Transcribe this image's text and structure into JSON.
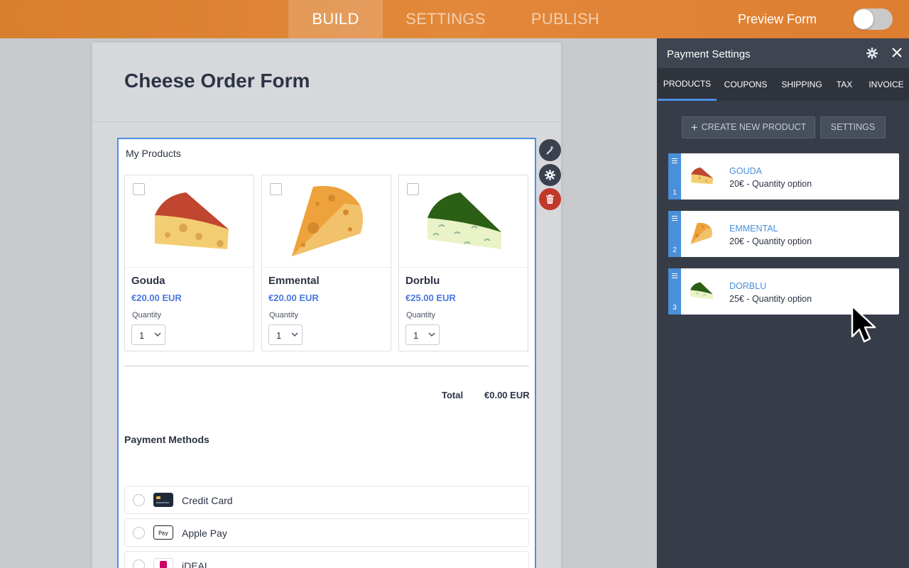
{
  "topbar": {
    "tabs": [
      {
        "label": "BUILD",
        "active": true
      },
      {
        "label": "SETTINGS",
        "active": false
      },
      {
        "label": "PUBLISH",
        "active": false
      }
    ],
    "preview_label": "Preview Form",
    "preview_on": false
  },
  "form": {
    "title": "Cheese Order Form",
    "block_label": "My Products",
    "products": [
      {
        "name": "Gouda",
        "price": "€20.00 EUR",
        "quantity_label": "Quantity",
        "quantity": "1",
        "color": "#c0462f"
      },
      {
        "name": "Emmental",
        "price": "€20.00 EUR",
        "quantity_label": "Quantity",
        "quantity": "1",
        "color": "#eea23b"
      },
      {
        "name": "Dorblu",
        "price": "€25.00 EUR",
        "quantity_label": "Quantity",
        "quantity": "1",
        "color": "#2c5f16"
      }
    ],
    "total_label": "Total",
    "total_value": "€0.00 EUR",
    "payment_title": "Payment Methods",
    "payment_methods": [
      {
        "label": "Credit Card",
        "icon": "credit-card-icon"
      },
      {
        "label": "Apple Pay",
        "icon": "apple-pay-icon"
      },
      {
        "label": "iDEAL",
        "icon": "ideal-icon"
      }
    ]
  },
  "panel": {
    "title": "Payment Settings",
    "tabs": [
      "PRODUCTS",
      "COUPONS",
      "SHIPPING",
      "TAX",
      "INVOICE"
    ],
    "active_tab": "PRODUCTS",
    "create_button": "CREATE NEW PRODUCT",
    "settings_button": "SETTINGS",
    "items": [
      {
        "index": "1",
        "name": "GOUDA",
        "desc": "20€ - Quantity option"
      },
      {
        "index": "2",
        "name": "EMMENTAL",
        "desc": "20€ - Quantity option"
      },
      {
        "index": "3",
        "name": "DORBLU",
        "desc": "25€ - Quantity option"
      }
    ]
  },
  "colors": {
    "accent": "#4a8fd9",
    "topbar": "#e2883a",
    "panel_bg": "#373d48",
    "price": "#4a78e0",
    "delete": "#c0392b"
  }
}
